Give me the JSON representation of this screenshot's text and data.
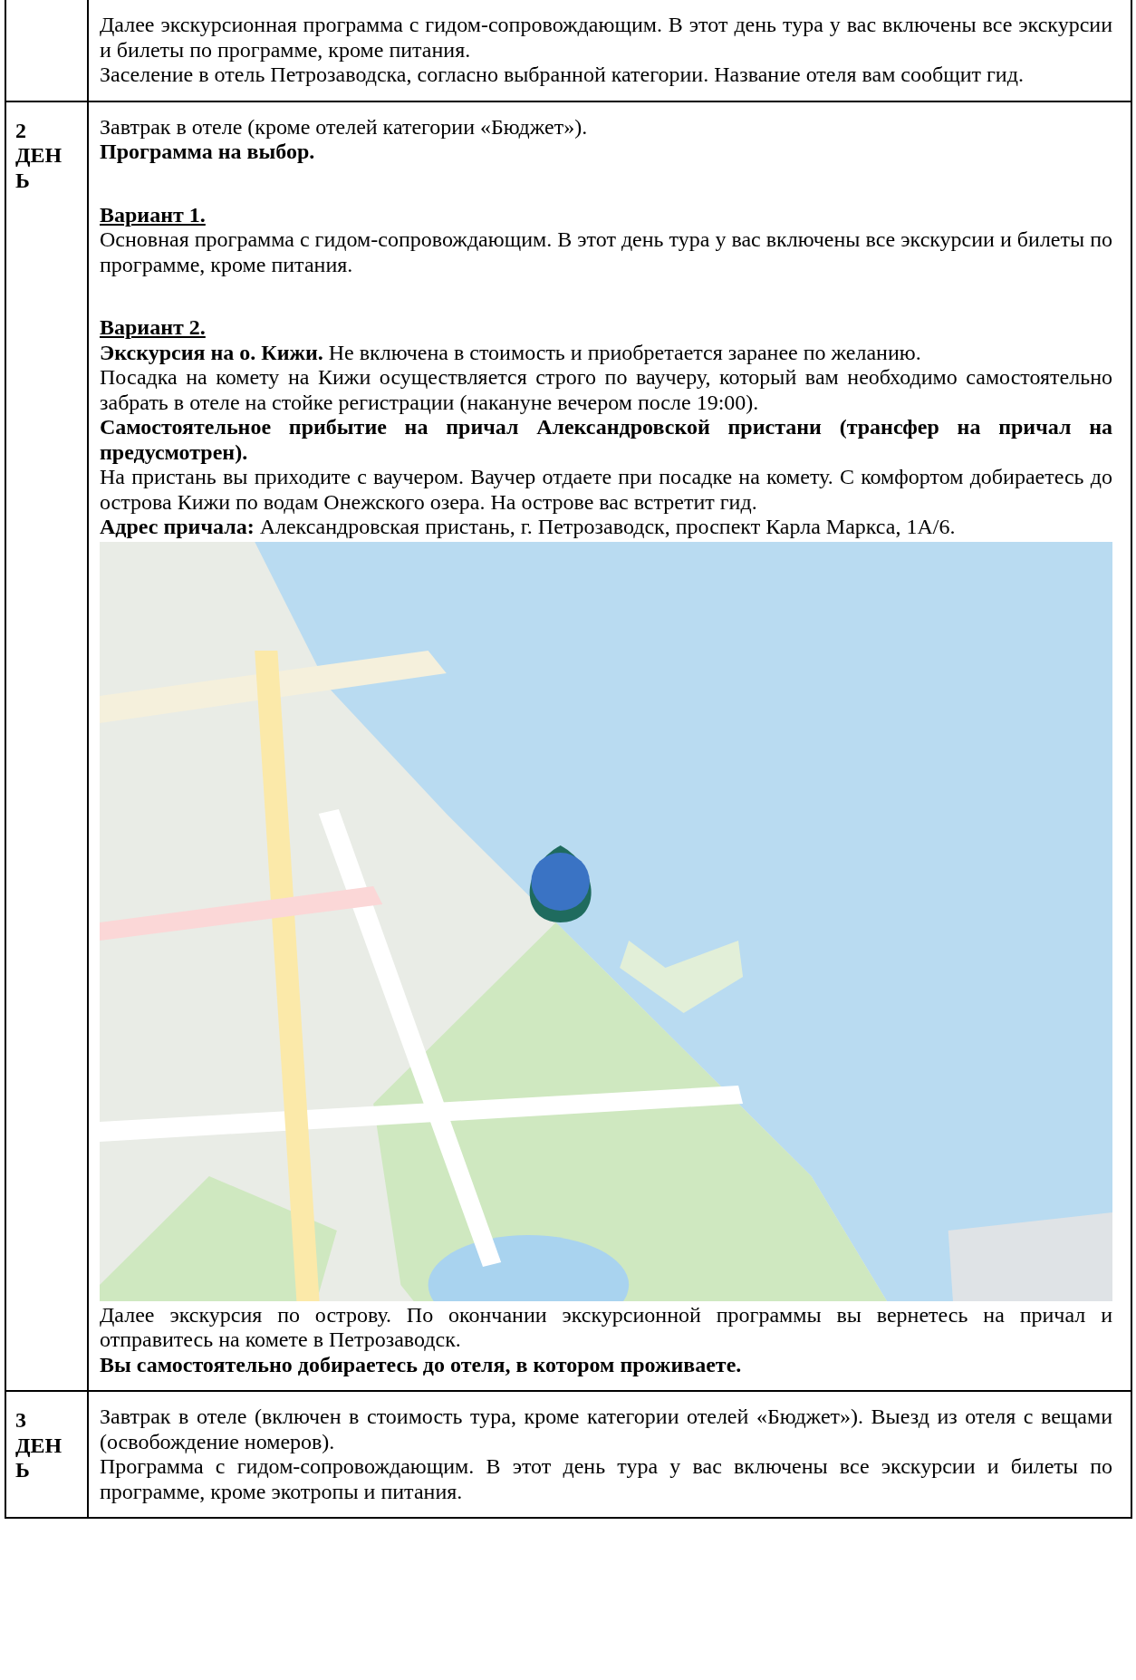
{
  "rows": [
    {
      "blocks": [
        {
          "kind": "text",
          "text": "Далее экскурсионная программа с гидом-сопровождающим. В этот день тура у вас включены все экскурсии и билеты по программе, кроме питания."
        },
        {
          "kind": "text",
          "text": "Заселение в отель Петрозаводска, согласно выбранной категории. Название отеля вам сообщит гид."
        }
      ]
    },
    {
      "day": {
        "number": "2",
        "word": "ДЕНЬ"
      },
      "blocks": [
        {
          "kind": "text",
          "text": "Завтрак в отеле (кроме отелей категории «Бюджет»)."
        },
        {
          "kind": "bold",
          "text": "Программа на выбор."
        },
        {
          "kind": "heading",
          "text": "Вариант 1."
        },
        {
          "kind": "text",
          "text": "Основная программа с гидом-сопровождающим. В этот день тура у вас включены все экскурсии и билеты по программе, кроме питания."
        },
        {
          "kind": "heading",
          "text": "Вариант 2."
        },
        {
          "kind": "text",
          "text": "**Экскурсия на о. Кижи.** Не включена в стоимость и приобретается заранее по желанию."
        },
        {
          "kind": "text",
          "text": "Посадка на комету на Кижи осуществляется строго по ваучеру, который вам необходимо самостоятельно забрать в отеле на стойке регистрации (накануне вечером после 19:00)."
        },
        {
          "kind": "bold",
          "text": "Самостоятельное прибытие на причал Александровской пристани (трансфер на причал на предусмотрен)."
        },
        {
          "kind": "text",
          "text": "На пристань вы приходите с ваучером. Ваучер отдаете при посадке на комету. С комфортом добираетесь до острова Кижи по водам Онежского озера. На острове вас встретит гид."
        },
        {
          "kind": "text",
          "text": "**Адрес причала:** Александровская пристань, г. Петрозаводск, проспект Карла Маркса, 1А/6."
        },
        {
          "kind": "picture"
        },
        {
          "kind": "text",
          "text": "Далее экскурсия по острову. По окончании экскурсионной программы вы вернетесь на причал и отправитесь на комете в Петрозаводск."
        },
        {
          "kind": "bold",
          "text": "Вы самостоятельно добираетесь до отеля, в котором проживаете."
        }
      ]
    },
    {
      "day": {
        "number": "3",
        "word": "ДЕНЬ"
      },
      "blocks": [
        {
          "kind": "text",
          "text": "Завтрак в отеле (включен в стоимость тура, кроме категории отелей «Бюджет»). Выезд из отеля с вещами (освобождение номеров)."
        },
        {
          "kind": "text",
          "text": "Программа с гидом-сопровождающим. В этот день тура у вас включены все экскурсии и билеты по программе, кроме экотропы и питания."
        }
      ]
    }
  ]
}
